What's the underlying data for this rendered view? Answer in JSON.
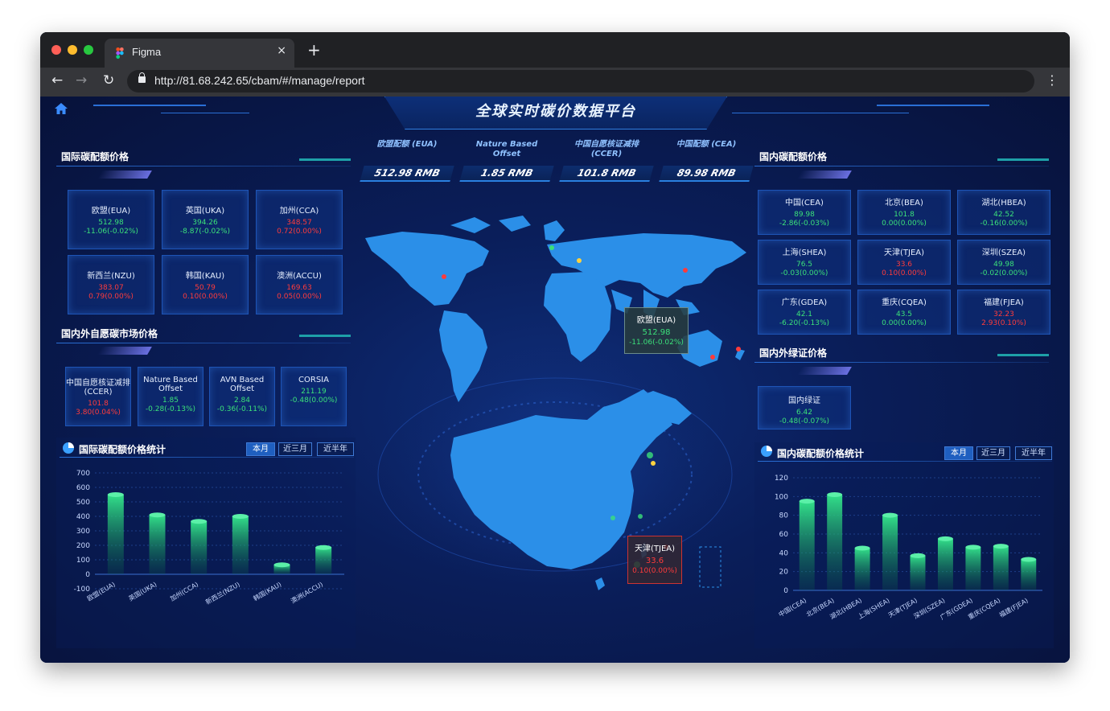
{
  "browser": {
    "tab_title": "Figma",
    "tab_close": "×",
    "new_tab": "+",
    "url": "http://81.68.242.65/cbam/#/manage/report",
    "back": "←",
    "forward": "→",
    "reload": "↻",
    "menu": "⋮"
  },
  "app": {
    "title": "全球实时碳价数据平台"
  },
  "highlights": [
    {
      "label": "欧盟配额 (EUA)",
      "value": "512.98 RMB"
    },
    {
      "label": "Nature Based Offset",
      "value": "1.85 RMB"
    },
    {
      "label": "中国自愿核证减排 (CCER)",
      "value": "101.8 RMB"
    },
    {
      "label": "中国配额 (CEA)",
      "value": "89.98 RMB"
    }
  ],
  "intl_quota": {
    "title": "国际碳配额价格",
    "cards": [
      {
        "name": "欧盟(EUA)",
        "value": "512.98",
        "change": "-11.06(-0.02%)",
        "value_color": "green",
        "change_color": "green"
      },
      {
        "name": "英国(UKA)",
        "value": "394.26",
        "change": "-8.87(-0.02%)",
        "value_color": "green",
        "change_color": "green"
      },
      {
        "name": "加州(CCA)",
        "value": "348.57",
        "change": "0.72(0.00%)",
        "value_color": "red",
        "change_color": "red"
      },
      {
        "name": "新西兰(NZU)",
        "value": "383.07",
        "change": "0.79(0.00%)",
        "value_color": "red",
        "change_color": "red"
      },
      {
        "name": "韩国(KAU)",
        "value": "50.79",
        "change": "0.10(0.00%)",
        "value_color": "red",
        "change_color": "red"
      },
      {
        "name": "澳洲(ACCU)",
        "value": "169.63",
        "change": "0.05(0.00%)",
        "value_color": "red",
        "change_color": "red"
      }
    ]
  },
  "voluntary": {
    "title": "国内外自愿碳市场价格",
    "cards": [
      {
        "name": "中国自愿核证减排 (CCER)",
        "value": "101.8",
        "change": "3.80(0.04%)",
        "value_color": "red",
        "change_color": "red"
      },
      {
        "name": "Nature Based Offset",
        "value": "1.85",
        "change": "-0.28(-0.13%)",
        "value_color": "green",
        "change_color": "green"
      },
      {
        "name": "AVN Based Offset",
        "value": "2.84",
        "change": "-0.36(-0.11%)",
        "value_color": "green",
        "change_color": "green"
      },
      {
        "name": "CORSIA",
        "value": "211.19",
        "change": "-0.48(0.00%)",
        "value_color": "green",
        "change_color": "green"
      }
    ]
  },
  "domestic_quota": {
    "title": "国内碳配额价格",
    "cards": [
      {
        "name": "中国(CEA)",
        "value": "89.98",
        "change": "-2.86(-0.03%)",
        "value_color": "green",
        "change_color": "green"
      },
      {
        "name": "北京(BEA)",
        "value": "101.8",
        "change": "0.00(0.00%)",
        "value_color": "green",
        "change_color": "green"
      },
      {
        "name": "湖北(HBEA)",
        "value": "42.52",
        "change": "-0.16(0.00%)",
        "value_color": "green",
        "change_color": "green"
      },
      {
        "name": "上海(SHEA)",
        "value": "76.5",
        "change": "-0.03(0.00%)",
        "value_color": "green",
        "change_color": "green"
      },
      {
        "name": "天津(TJEA)",
        "value": "33.6",
        "change": "0.10(0.00%)",
        "value_color": "red",
        "change_color": "red"
      },
      {
        "name": "深圳(SZEA)",
        "value": "49.98",
        "change": "-0.02(0.00%)",
        "value_color": "green",
        "change_color": "green"
      },
      {
        "name": "广东(GDEA)",
        "value": "42.1",
        "change": "-6.20(-0.13%)",
        "value_color": "green",
        "change_color": "green"
      },
      {
        "name": "重庆(CQEA)",
        "value": "43.5",
        "change": "0.00(0.00%)",
        "value_color": "green",
        "change_color": "green"
      },
      {
        "name": "福建(FJEA)",
        "value": "32.23",
        "change": "2.93(0.10%)",
        "value_color": "red",
        "change_color": "red"
      }
    ]
  },
  "green_cert": {
    "title": "国内外绿证价格",
    "cards": [
      {
        "name": "国内绿证",
        "value": "6.42",
        "change": "-0.48(-0.07%)",
        "value_color": "green",
        "change_color": "green"
      }
    ]
  },
  "map_tooltips": {
    "world": {
      "name": "欧盟(EUA)",
      "value": "512.98",
      "change": "-11.06(-0.02%)"
    },
    "china": {
      "name": "天津(TJEA)",
      "value": "33.6",
      "change": "0.10(0.00%)"
    }
  },
  "period_tabs": [
    "本月",
    "近三月",
    "近半年"
  ],
  "colors": {
    "accent": "#1f5fc0",
    "up": "#ff3b3b",
    "down": "#3be07a",
    "bar_top": "#33e08a",
    "land": "#2b8fe8"
  },
  "chart_data": [
    {
      "type": "bar",
      "title": "国际碳配额价格统计",
      "categories": [
        "欧盟(EUA)",
        "英国(UKA)",
        "加州(CCA)",
        "新西兰(NZU)",
        "韩国(KAU)",
        "澳洲(ACCU)"
      ],
      "values": [
        550,
        410,
        365,
        400,
        65,
        185
      ],
      "ylim": [
        -100,
        700
      ],
      "yticks": [
        700,
        600,
        500,
        400,
        300,
        200,
        100,
        0,
        -100
      ],
      "grid": true
    },
    {
      "type": "bar",
      "title": "国内碳配额价格统计",
      "categories": [
        "中国(CEA)",
        "北京(BEA)",
        "湖北(HBEA)",
        "上海(SHEA)",
        "天津(TJEA)",
        "深圳(SZEA)",
        "广东(GDEA)",
        "重庆(CQEA)",
        "福建(FJEA)"
      ],
      "values": [
        95,
        102,
        45,
        80,
        37,
        55,
        46,
        47,
        33
      ],
      "ylim": [
        0,
        120
      ],
      "yticks": [
        120,
        100,
        80,
        60,
        40,
        20,
        0
      ],
      "grid": true
    }
  ]
}
